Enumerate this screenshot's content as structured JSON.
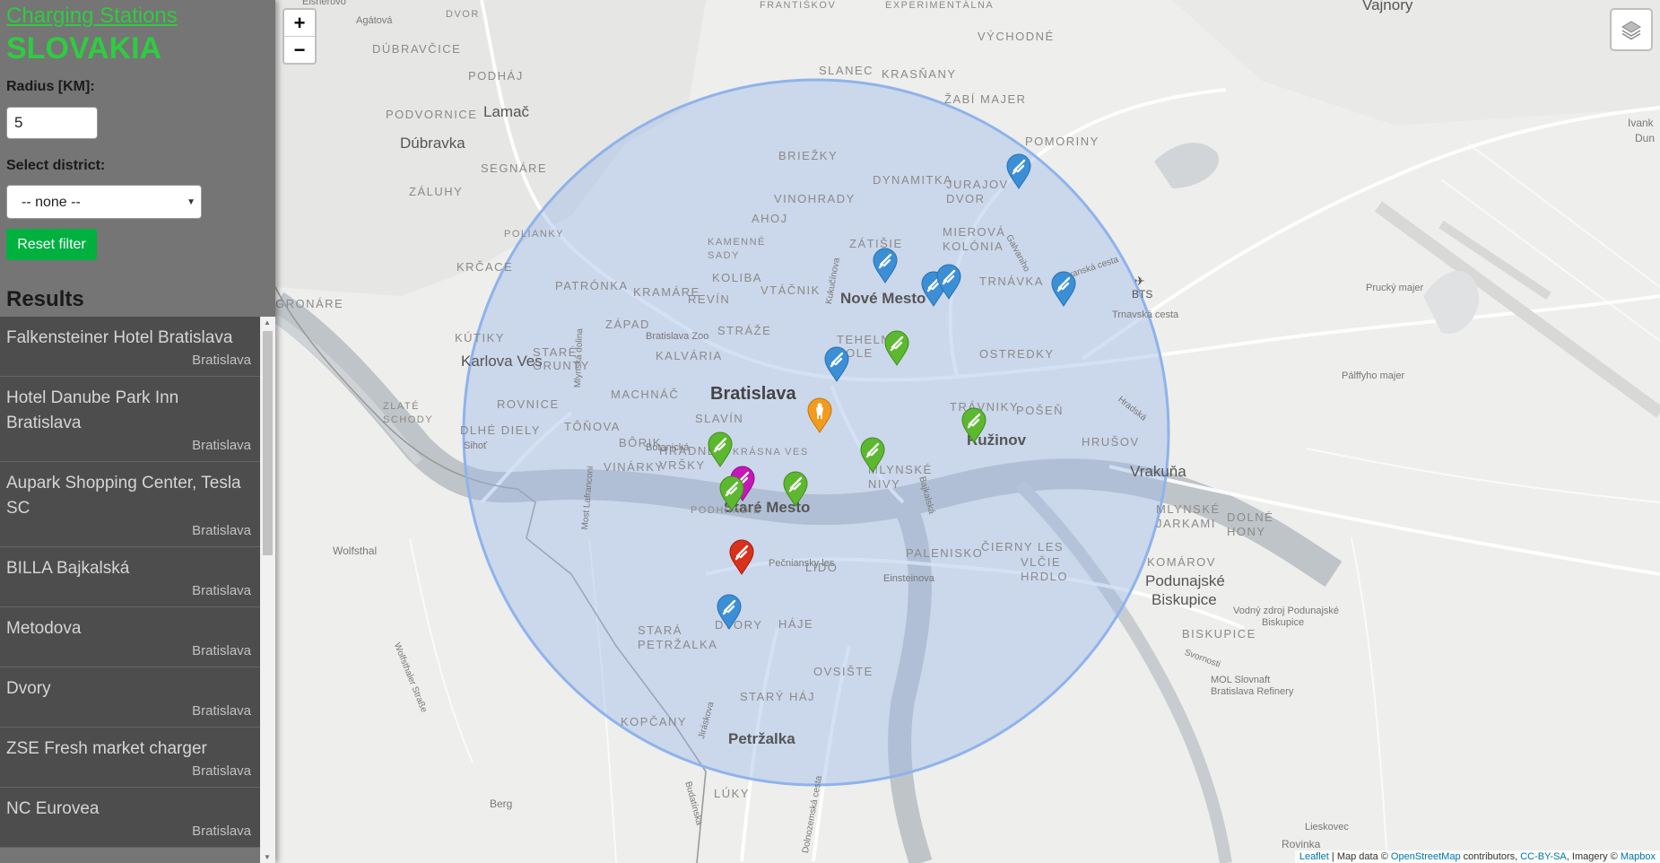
{
  "sidebar": {
    "title": "Charging Stations",
    "country": "SLOVAKIA",
    "radius_label": "Radius [KM]:",
    "radius_value": "5",
    "district_label": "Select district:",
    "district_selected": "-- none --",
    "reset_label": "Reset filter",
    "results_heading": "Results",
    "results": [
      {
        "name": "Falkensteiner Hotel Bratislava",
        "city": "Bratislava"
      },
      {
        "name": "Hotel Danube Park Inn Bratislava",
        "city": "Bratislava"
      },
      {
        "name": "Aupark Shopping Center, Tesla SC",
        "city": "Bratislava"
      },
      {
        "name": "BILLA Bajkalská",
        "city": "Bratislava"
      },
      {
        "name": "Metodova",
        "city": "Bratislava"
      },
      {
        "name": "Dvory",
        "city": "Bratislava"
      },
      {
        "name": "ZSE Fresh market charger",
        "city": "Bratislava"
      },
      {
        "name": "NC Eurovea",
        "city": "Bratislava"
      }
    ]
  },
  "map": {
    "zoom_in": "+",
    "zoom_out": "−",
    "attribution": {
      "leaflet": "Leaflet",
      "sep1": " | Map data © ",
      "osm": "OpenStreetMap",
      "sep2": " contributors, ",
      "license": "CC-BY-SA",
      "sep3": ", Imagery © ",
      "mapbox": "Mapbox"
    },
    "labels": {
      "vajnory": "Vajnory",
      "lamac": "Lamač",
      "dubravka": "Dúbravka",
      "karlova_ves": "Karlova Ves",
      "bratislava": "Bratislava",
      "nove_mesto": "Nové Mesto",
      "stare_mesto": "Staré Mesto",
      "ruzinov": "Ružinov",
      "petrzalka": "Petržalka",
      "vrakuna": "Vrakuňa",
      "podunajske": "Podunajské",
      "biskupice": "Biskupice",
      "bts": "BTS",
      "agatova": "Agátová",
      "dubravcie": "DÚBRAVČICE",
      "podhaj": "PODHÁJ",
      "podvornice": "PODVORNICE",
      "segnare": "SEGNÁRE",
      "zaluhy": "ZÁLUHY",
      "polianky": "POLIANKY",
      "krcace": "KRČACE",
      "patronka": "PATRÓNKA",
      "gronare": "GRONÁRE",
      "kutiky": "KÚTIKY",
      "stare_grunty": "STARÉ GRUNTY",
      "rovnice": "ROVNICE",
      "zlate_schody": "ZLATÉ SCHODY",
      "dlhe_diely": "DLHÉ DIELY",
      "slanec": "SLANEC",
      "krasnany": "KRASŇANY",
      "zabi_majer": "ŽABÍ MAJER",
      "vychodne": "VÝCHODNÉ",
      "experimentalna": "EXPERIMENTÁLNA",
      "pomoriny": "POMORINY",
      "briezky": "BRIEŽKY",
      "dynamitka": "DYNAMITKA",
      "jurajov_dvor": "JURAJOV DVOR",
      "vinohrady": "VINOHRADY",
      "ahoj": "AHOJ",
      "zatisie": "ZÁTIŠIE",
      "mierova_kolonia": "MIEROVÁ KOLÓNIA",
      "kamenne_sady": "KAMENNÉ SADY",
      "koliba": "KOLIBA",
      "kramare": "KRAMÁRE",
      "revin": "REVÍN",
      "vtacnik": "VTÁČNIK",
      "trnavka": "TRNÁVKA",
      "zapad": "ZÁPAD",
      "straze": "STRÁŽE",
      "kalvaria": "KALVÁRIA",
      "machnac": "MACHNÁČ",
      "slavin": "SLAVÍN",
      "tonova": "TÔŇOVA",
      "borik": "BÔRIK",
      "hradne_vrsky": "HRADNÉ VRŠKY",
      "vinarky": "VINÁRKY",
      "krasna_ves": "KRÁSNA VES",
      "podhradie": "PODHRADIE",
      "tehelne_pole": "TEHELNÉ POLE",
      "ostredky": "OSTREDKY",
      "travniky": "TRÁVNIKY",
      "posen": "POŠEŇ",
      "hrusov": "HRUŠOV",
      "mlynske_nivy": "MLYNSKÉ NIVY",
      "palenisko": "PALENISKO",
      "cierny_les": "ČIERNY LES",
      "vlcie_hrdlo": "VLČIE HRDLO",
      "lido": "LIDO",
      "haje": "HÁJE",
      "dvory": "DVORY",
      "stara_petrzalka": "STARÁ PETRŽALKA",
      "ovsiste": "OVSIŠTE",
      "stary_haj": "STARÝ HÁJ",
      "kopcany": "KOPČANY",
      "luky": "LÚKY",
      "mlynske_jarkami": "MLYNSKÉ JARKAMI",
      "dolne_hony": "DOLNÉ HONY",
      "komarov": "KOMÁROV",
      "biskupice_upper": "BISKUPICE",
      "bratislava_zoo": "Bratislava Zoo",
      "botanicka": "Botanická",
      "sihot": "Sihoť",
      "wolfsthal": "Wolfsthal",
      "berg": "Berg",
      "trnavska": "Trnavská cesta",
      "einsteinova": "Einsteinova",
      "pecniansky_les": "Pečniansky les",
      "mlynska_dolina": "Mlynská dolina",
      "most_lafranconi": "Most Lafranconi",
      "bajkalska": "Bajkalská",
      "kukucinova": "Kukučínova",
      "galvaniho": "Galvaniho",
      "ivanska": "Ivanská cesta",
      "hradska": "Hradská",
      "svornosti": "Svornosti",
      "jiraskova": "Jiráskova",
      "budatinska": "Budatínska",
      "dolnozemska": "Dolnozemská cesta",
      "wolfsthaler": "Wolfsthaler Straße",
      "prucky": "Prucký majer",
      "palffyho": "Pálffyho majer",
      "mol": "MOL Slovnaft",
      "mol2": "Bratislava Refinery",
      "vodny_zdroj": "Vodný zdroj Podunajské",
      "vodny_zdroj2": "Biskupice",
      "lieskovec": "Lieskovec",
      "rovinka": "Rovinka",
      "ivanka": "Ivank",
      "dun": "Dun",
      "frantiskov": "FRANTIŠKOV",
      "dvor": "DVOR",
      "eisnerovo": "Eisnerovo"
    }
  },
  "colors": {
    "accent_green": "#2ecc40",
    "sidebar_bg": "#757575",
    "result_bg": "#4d4d4d",
    "circle_fill": "#9ab7e6",
    "marker_blue": "#3a8fd6",
    "marker_green": "#5cb82e",
    "marker_red": "#d8311c",
    "marker_magenta": "#c617b8",
    "marker_orange": "#f29b1d"
  },
  "icons": {
    "layers": "layers-icon",
    "plug": "plug-icon",
    "person": "person-icon"
  }
}
